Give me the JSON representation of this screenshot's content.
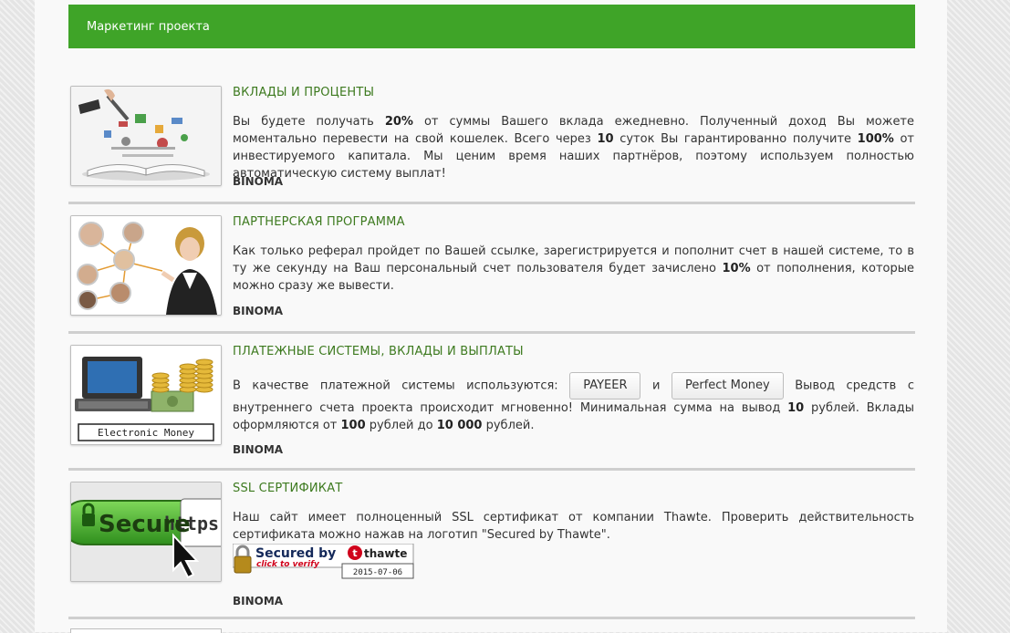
{
  "header": {
    "title": "Маркетинг проекта"
  },
  "items": [
    {
      "title": "ВКЛАДЫ И ПРОЦЕНТЫ",
      "t1": "Вы будете получать ",
      "b1": "20%",
      "t2": " от суммы Вашего вклада ежедневно. Полученный доход Вы можете моментально перевести на свой кошелек. Всего через ",
      "b2": "10",
      "t3": " суток Вы гарантированно получите ",
      "b3": "100%",
      "t4": " от инвестируемого капитала. Мы ценим время наших партнёров, поэтому используем полностью автоматическую систему выплат!",
      "sig": "BINOMA"
    },
    {
      "title": "ПАРТНЕРСКАЯ ПРОГРАММА",
      "t1": "Как только реферал пройдет по Вашей ссылке, зарегистрируется и пополнит счет в нашей системе, то в ту же секунду на Ваш персональный счет пользователя будет зачислено ",
      "b1": "10%",
      "t2": " от пополнения, которые можно сразу же вывести.",
      "sig": "BINOMA"
    },
    {
      "title": "ПЛАТЕЖНЫЕ СИСТЕМЫ, ВКЛАДЫ И ВЫПЛАТЫ",
      "t1": "В качестве платежной системы используются:",
      "btn1": "PAYEER",
      "and": "и",
      "btn2": "Perfect Money",
      "t2": "Вывод средств с внутреннего счета проекта происходит мгновенно! Минимальная сумма на вывод ",
      "b1": "10",
      "t3": " рублей. Вклады оформляются от ",
      "b2": "100",
      "t4": " рублей до ",
      "b3": "10 000",
      "t5": " рублей.",
      "image_caption": "Electronic Money",
      "sig": "BINOMA"
    },
    {
      "title": "SSL СЕРТИФИКАТ",
      "t1": "Наш сайт имеет полноценный SSL сертификат от компании Thawte. Проверить действительность сертификата можно нажав на логотип \"Secured by Thawte\".",
      "image_word1": "Secure",
      "image_word2": "https://",
      "seal_top": "Secured by",
      "seal_brand": "thawte",
      "seal_sub": "click to verify",
      "seal_date": "2015-07-06",
      "sig": "BINOMA"
    }
  ]
}
